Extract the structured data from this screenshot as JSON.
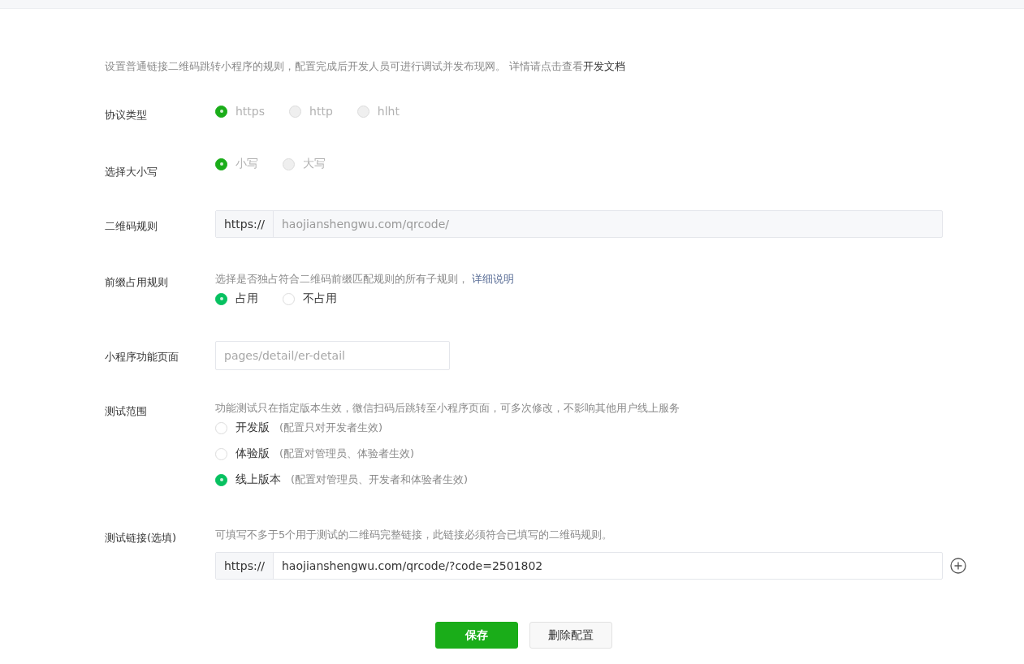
{
  "intro": {
    "text": "设置普通链接二维码跳转小程序的规则，配置完成后开发人员可进行调试并发布现网。 详情请点击查看",
    "link": "开发文档"
  },
  "protocol": {
    "label": "协议类型",
    "disabled": true,
    "options": [
      {
        "label": "https",
        "selected": true
      },
      {
        "label": "http",
        "selected": false
      },
      {
        "label": "hlht",
        "selected": false
      }
    ]
  },
  "letter_case": {
    "label": "选择大小写",
    "disabled": true,
    "options": [
      {
        "label": "小写",
        "selected": true
      },
      {
        "label": "大写",
        "selected": false
      }
    ]
  },
  "qr_rule": {
    "label": "二维码规则",
    "prefix": "https://",
    "value": "haojianshengwu.com/qrcode/",
    "disabled": true
  },
  "prefix_rule": {
    "label": "前缀占用规则",
    "description": "选择是否独占符合二维码前缀匹配规则的所有子规则，",
    "link": "详细说明",
    "options": [
      {
        "label": "占用",
        "selected": true
      },
      {
        "label": "不占用",
        "selected": false
      }
    ]
  },
  "page_path": {
    "label": "小程序功能页面",
    "placeholder": "pages/detail/er-detail"
  },
  "test_scope": {
    "label": "测试范围",
    "description": "功能测试只在指定版本生效，微信扫码后跳转至小程序页面，可多次修改，不影响其他用户线上服务",
    "options": [
      {
        "label": "开发版",
        "note": "(配置只对开发者生效)",
        "selected": false
      },
      {
        "label": "体验版",
        "note": "(配置对管理员、体验者生效)",
        "selected": false
      },
      {
        "label": "线上版本",
        "note": "(配置对管理员、开发者和体验者生效)",
        "selected": true
      }
    ]
  },
  "test_link": {
    "label": "测试链接(选填)",
    "description": "可填写不多于5个用于测试的二维码完整链接，此链接必须符合已填写的二维码规则。",
    "prefix": "https://",
    "value": "haojianshengwu.com/qrcode/?code=2501802",
    "disabled": false
  },
  "buttons": [
    {
      "label": "保存",
      "kind": "primary"
    },
    {
      "label": "删除配置",
      "kind": "default"
    }
  ]
}
